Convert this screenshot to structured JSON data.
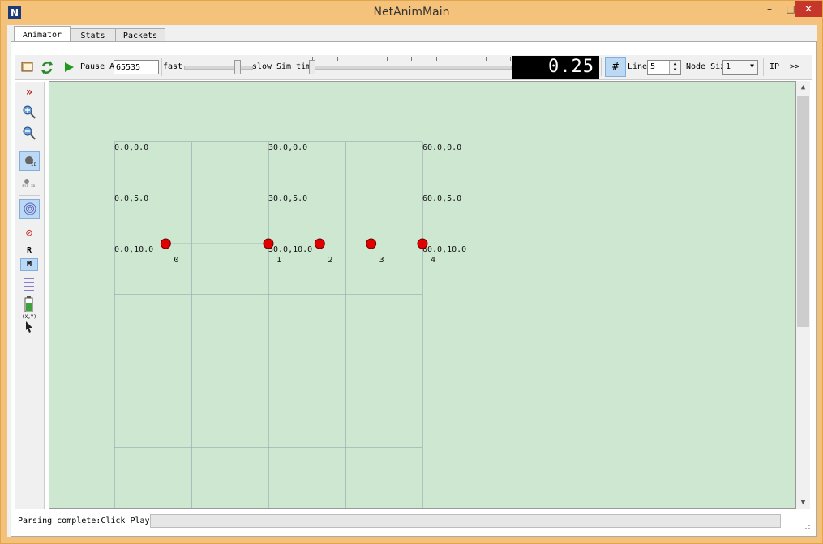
{
  "window": {
    "title": "NetAnimMain",
    "app_icon_letter": "N",
    "min_glyph": "–",
    "max_glyph": "□",
    "close_glyph": "✕"
  },
  "tabs": [
    {
      "label": "Animator",
      "active": true
    },
    {
      "label": "Stats",
      "active": false
    },
    {
      "label": "Packets",
      "active": false
    }
  ],
  "toolbar": {
    "pause_at_label": "Pause At",
    "pause_at_value": "65535",
    "fast_label": "fast",
    "slow_label": "slow",
    "sim_time_label": "Sim time",
    "sim_time_display": "0.25",
    "lines_label": "Lines",
    "lines_value": "5",
    "node_size_label": "Node Size",
    "node_size_value": "1",
    "ip_label": "IP",
    "more_label": ">>",
    "speed_slider_fraction": 0.8,
    "sim_slider_fraction": 0.0
  },
  "sidebar": {
    "r_label": "R",
    "m_label": "M",
    "xy_label": "(X,Y)",
    "sysid_label": "SYS ID",
    "id_label": "ID"
  },
  "canvas": {
    "coord_labels": [
      "0.0,0.0",
      "30.0,0.0",
      "60.0,0.0",
      "0.0,5.0",
      "30.0,5.0",
      "60.0,5.0",
      "0.0,10.0",
      "30.0,10.0",
      "60.0,10.0"
    ],
    "nodes": [
      {
        "id": "0",
        "x": 10,
        "y": 10
      },
      {
        "id": "1",
        "x": 30,
        "y": 10
      },
      {
        "id": "2",
        "x": 40,
        "y": 10
      },
      {
        "id": "3",
        "x": 50,
        "y": 10
      },
      {
        "id": "4",
        "x": 60,
        "y": 10
      }
    ],
    "links": [
      [
        0,
        1
      ]
    ],
    "node_color": "#e00000",
    "background_color": "#cde7d0",
    "grid_color": "#98a8b4"
  },
  "status": {
    "text": "Parsing complete:Click Play"
  }
}
